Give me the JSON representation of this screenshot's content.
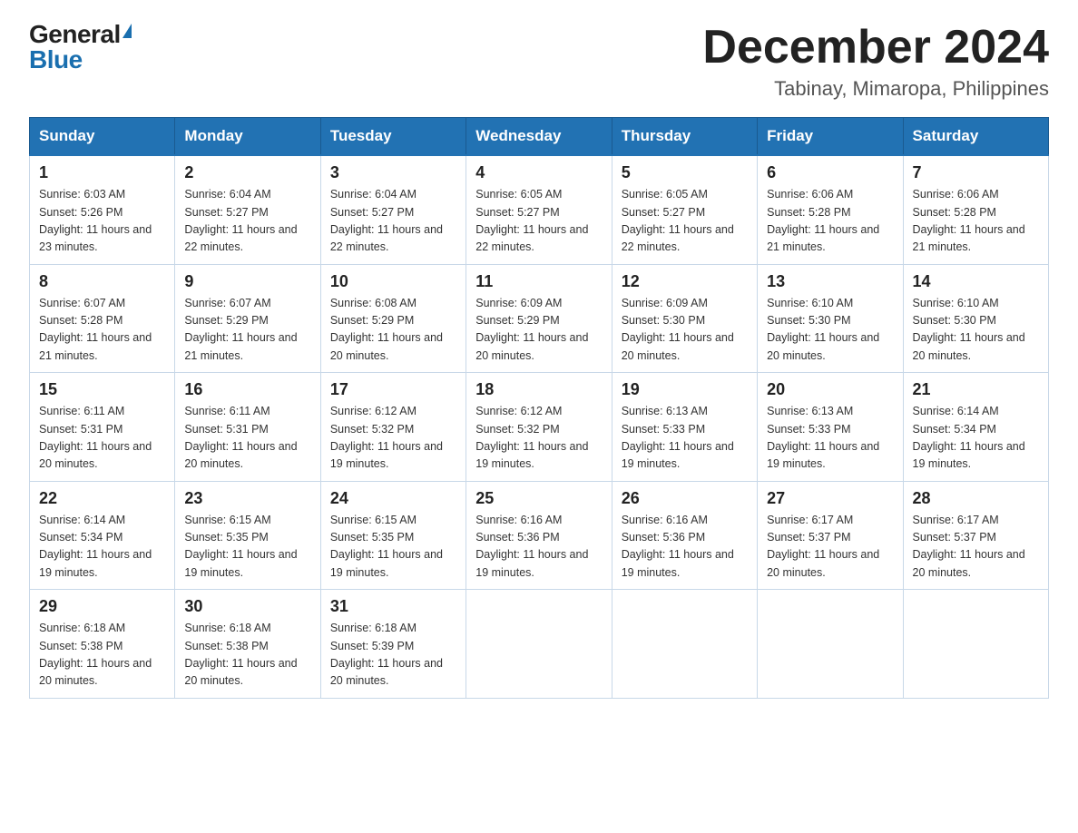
{
  "logo": {
    "general": "General",
    "blue": "Blue"
  },
  "title": "December 2024",
  "subtitle": "Tabinay, Mimaropa, Philippines",
  "headers": [
    "Sunday",
    "Monday",
    "Tuesday",
    "Wednesday",
    "Thursday",
    "Friday",
    "Saturday"
  ],
  "weeks": [
    [
      {
        "day": "1",
        "sunrise": "6:03 AM",
        "sunset": "5:26 PM",
        "daylight": "11 hours and 23 minutes."
      },
      {
        "day": "2",
        "sunrise": "6:04 AM",
        "sunset": "5:27 PM",
        "daylight": "11 hours and 22 minutes."
      },
      {
        "day": "3",
        "sunrise": "6:04 AM",
        "sunset": "5:27 PM",
        "daylight": "11 hours and 22 minutes."
      },
      {
        "day": "4",
        "sunrise": "6:05 AM",
        "sunset": "5:27 PM",
        "daylight": "11 hours and 22 minutes."
      },
      {
        "day": "5",
        "sunrise": "6:05 AM",
        "sunset": "5:27 PM",
        "daylight": "11 hours and 22 minutes."
      },
      {
        "day": "6",
        "sunrise": "6:06 AM",
        "sunset": "5:28 PM",
        "daylight": "11 hours and 21 minutes."
      },
      {
        "day": "7",
        "sunrise": "6:06 AM",
        "sunset": "5:28 PM",
        "daylight": "11 hours and 21 minutes."
      }
    ],
    [
      {
        "day": "8",
        "sunrise": "6:07 AM",
        "sunset": "5:28 PM",
        "daylight": "11 hours and 21 minutes."
      },
      {
        "day": "9",
        "sunrise": "6:07 AM",
        "sunset": "5:29 PM",
        "daylight": "11 hours and 21 minutes."
      },
      {
        "day": "10",
        "sunrise": "6:08 AM",
        "sunset": "5:29 PM",
        "daylight": "11 hours and 20 minutes."
      },
      {
        "day": "11",
        "sunrise": "6:09 AM",
        "sunset": "5:29 PM",
        "daylight": "11 hours and 20 minutes."
      },
      {
        "day": "12",
        "sunrise": "6:09 AM",
        "sunset": "5:30 PM",
        "daylight": "11 hours and 20 minutes."
      },
      {
        "day": "13",
        "sunrise": "6:10 AM",
        "sunset": "5:30 PM",
        "daylight": "11 hours and 20 minutes."
      },
      {
        "day": "14",
        "sunrise": "6:10 AM",
        "sunset": "5:30 PM",
        "daylight": "11 hours and 20 minutes."
      }
    ],
    [
      {
        "day": "15",
        "sunrise": "6:11 AM",
        "sunset": "5:31 PM",
        "daylight": "11 hours and 20 minutes."
      },
      {
        "day": "16",
        "sunrise": "6:11 AM",
        "sunset": "5:31 PM",
        "daylight": "11 hours and 20 minutes."
      },
      {
        "day": "17",
        "sunrise": "6:12 AM",
        "sunset": "5:32 PM",
        "daylight": "11 hours and 19 minutes."
      },
      {
        "day": "18",
        "sunrise": "6:12 AM",
        "sunset": "5:32 PM",
        "daylight": "11 hours and 19 minutes."
      },
      {
        "day": "19",
        "sunrise": "6:13 AM",
        "sunset": "5:33 PM",
        "daylight": "11 hours and 19 minutes."
      },
      {
        "day": "20",
        "sunrise": "6:13 AM",
        "sunset": "5:33 PM",
        "daylight": "11 hours and 19 minutes."
      },
      {
        "day": "21",
        "sunrise": "6:14 AM",
        "sunset": "5:34 PM",
        "daylight": "11 hours and 19 minutes."
      }
    ],
    [
      {
        "day": "22",
        "sunrise": "6:14 AM",
        "sunset": "5:34 PM",
        "daylight": "11 hours and 19 minutes."
      },
      {
        "day": "23",
        "sunrise": "6:15 AM",
        "sunset": "5:35 PM",
        "daylight": "11 hours and 19 minutes."
      },
      {
        "day": "24",
        "sunrise": "6:15 AM",
        "sunset": "5:35 PM",
        "daylight": "11 hours and 19 minutes."
      },
      {
        "day": "25",
        "sunrise": "6:16 AM",
        "sunset": "5:36 PM",
        "daylight": "11 hours and 19 minutes."
      },
      {
        "day": "26",
        "sunrise": "6:16 AM",
        "sunset": "5:36 PM",
        "daylight": "11 hours and 19 minutes."
      },
      {
        "day": "27",
        "sunrise": "6:17 AM",
        "sunset": "5:37 PM",
        "daylight": "11 hours and 20 minutes."
      },
      {
        "day": "28",
        "sunrise": "6:17 AM",
        "sunset": "5:37 PM",
        "daylight": "11 hours and 20 minutes."
      }
    ],
    [
      {
        "day": "29",
        "sunrise": "6:18 AM",
        "sunset": "5:38 PM",
        "daylight": "11 hours and 20 minutes."
      },
      {
        "day": "30",
        "sunrise": "6:18 AM",
        "sunset": "5:38 PM",
        "daylight": "11 hours and 20 minutes."
      },
      {
        "day": "31",
        "sunrise": "6:18 AM",
        "sunset": "5:39 PM",
        "daylight": "11 hours and 20 minutes."
      },
      null,
      null,
      null,
      null
    ]
  ]
}
